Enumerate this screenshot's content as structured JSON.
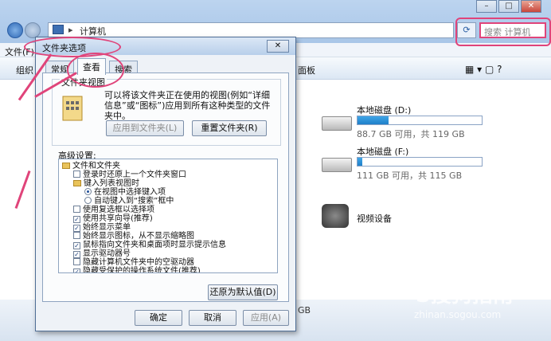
{
  "explorer": {
    "address": "计算机",
    "search_placeholder": "搜索 计算机",
    "menu_file": "文件(F)",
    "toolbar_org": "组织",
    "toolbar_control_panel": "面板",
    "drives": [
      {
        "name": "本地磁盘 (D:)",
        "free_text": "88.7 GB 可用，共 119 GB",
        "usage": 0.25
      },
      {
        "name": "本地磁盘 (F:)",
        "free_text": "111 GB 可用，共 115 GB",
        "usage": 0.04
      }
    ],
    "video_device": "视频设备",
    "status_size": "GB"
  },
  "dialog": {
    "title": "文件夹选项",
    "close": "✕",
    "tabs": [
      {
        "label": "常规"
      },
      {
        "label": "查看"
      },
      {
        "label": "搜索"
      }
    ],
    "folder_view": {
      "group_title": "文件夹视图",
      "description": "可以将该文件夹正在使用的视图(例如“详细信息”或“图标”)应用到所有这种类型的文件夹中。",
      "apply_button": "应用到文件夹(L)",
      "reset_button": "重置文件夹(R)"
    },
    "advanced_label": "高级设置:",
    "tree": [
      {
        "type": "folder",
        "indent": 0,
        "label": "文件和文件夹"
      },
      {
        "type": "check",
        "indent": 1,
        "checked": false,
        "label": "登录时还原上一个文件夹窗口"
      },
      {
        "type": "folder",
        "indent": 1,
        "label": "键入列表视图时"
      },
      {
        "type": "radio",
        "indent": 2,
        "checked": true,
        "label": "在视图中选择键入项"
      },
      {
        "type": "radio",
        "indent": 2,
        "checked": false,
        "label": "自动键入到“搜索”框中"
      },
      {
        "type": "check",
        "indent": 1,
        "checked": false,
        "label": "使用复选框以选择项"
      },
      {
        "type": "check",
        "indent": 1,
        "checked": true,
        "label": "使用共享向导(推荐)"
      },
      {
        "type": "check",
        "indent": 1,
        "checked": true,
        "label": "始终显示菜单"
      },
      {
        "type": "check",
        "indent": 1,
        "checked": false,
        "label": "始终显示图标，从不显示缩略图"
      },
      {
        "type": "check",
        "indent": 1,
        "checked": true,
        "label": "鼠标指向文件夹和桌面项时显示提示信息"
      },
      {
        "type": "check",
        "indent": 1,
        "checked": true,
        "label": "显示驱动器号"
      },
      {
        "type": "check",
        "indent": 1,
        "checked": false,
        "label": "隐藏计算机文件夹中的空驱动器"
      },
      {
        "type": "check",
        "indent": 1,
        "checked": true,
        "label": "隐藏受保护的操作系统文件(推荐)"
      }
    ],
    "restore_defaults": "还原为默认值(D)",
    "ok": "确定",
    "cancel": "取消",
    "apply": "应用(A)"
  },
  "watermark": {
    "brand": "S搜狗指南",
    "url": "zhinan.sogou.com"
  },
  "colors": {
    "annotation": "#e0447a",
    "title_bar": "#b8cfea",
    "progress": "#1f7fc9"
  }
}
